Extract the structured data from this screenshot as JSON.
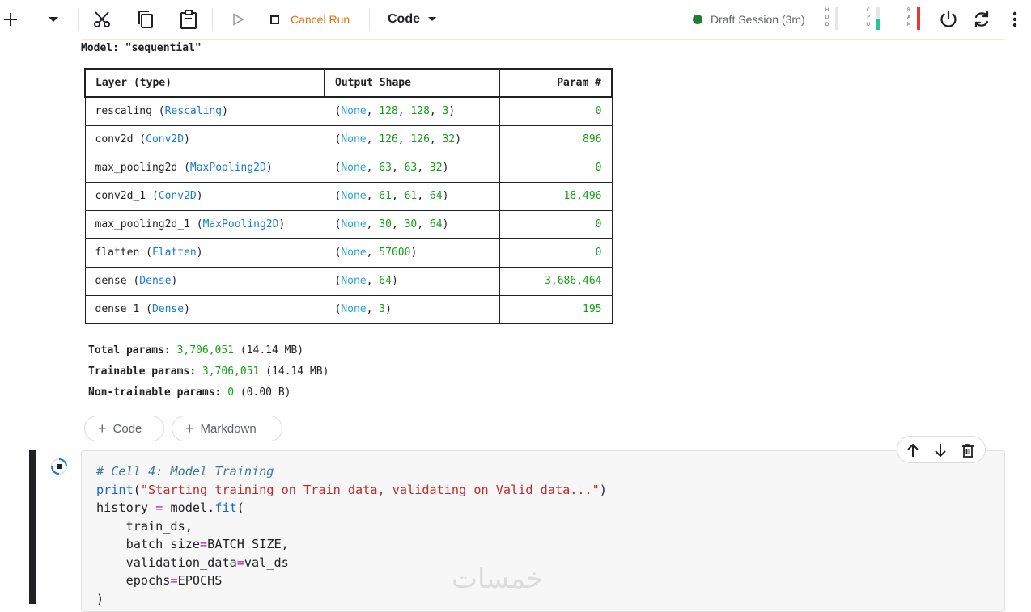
{
  "toolbar": {
    "cancel_run_label": "Cancel Run",
    "cell_type_label": "Code",
    "session_label": "Draft Session (3m)",
    "meters": [
      {
        "label": "HDD",
        "letters": [
          "H",
          "D",
          "D"
        ],
        "level": 0.0,
        "color": "#9e9e9e"
      },
      {
        "label": "CPU",
        "letters": [
          "C",
          "P",
          "U"
        ],
        "level": 0.45,
        "color": "#20c997"
      },
      {
        "label": "RAM",
        "letters": [
          "R",
          "A",
          "M"
        ],
        "level": 1.0,
        "color": "#e53935"
      }
    ]
  },
  "output": {
    "model_title": "Model: \"sequential\"",
    "columns": [
      "Layer (type)",
      "Output Shape",
      "Param #"
    ],
    "rows": [
      {
        "name": "rescaling",
        "type": "Rescaling",
        "shape": [
          "None",
          "128",
          "128",
          "3"
        ],
        "params": "0"
      },
      {
        "name": "conv2d",
        "type": "Conv2D",
        "shape": [
          "None",
          "126",
          "126",
          "32"
        ],
        "params": "896"
      },
      {
        "name": "max_pooling2d",
        "type": "MaxPooling2D",
        "shape": [
          "None",
          "63",
          "63",
          "32"
        ],
        "params": "0"
      },
      {
        "name": "conv2d_1",
        "type": "Conv2D",
        "shape": [
          "None",
          "61",
          "61",
          "64"
        ],
        "params": "18,496"
      },
      {
        "name": "max_pooling2d_1",
        "type": "MaxPooling2D",
        "shape": [
          "None",
          "30",
          "30",
          "64"
        ],
        "params": "0"
      },
      {
        "name": "flatten",
        "type": "Flatten",
        "shape": [
          "None",
          "57600"
        ],
        "params": "0"
      },
      {
        "name": "dense",
        "type": "Dense",
        "shape": [
          "None",
          "64"
        ],
        "params": "3,686,464"
      },
      {
        "name": "dense_1",
        "type": "Dense",
        "shape": [
          "None",
          "3"
        ],
        "params": "195"
      }
    ],
    "totals": [
      {
        "label": "Total params:",
        "value": "3,706,051",
        "size": "(14.14 MB)"
      },
      {
        "label": "Trainable params:",
        "value": "3,706,051",
        "size": "(14.14 MB)"
      },
      {
        "label": "Non-trainable params:",
        "value": "0",
        "size": "(0.00 B)"
      }
    ]
  },
  "add_buttons": {
    "code": "Code",
    "markdown": "Markdown"
  },
  "code_cell": {
    "lines": [
      [
        {
          "c": "comment",
          "t": "# Cell 4: Model Training"
        }
      ],
      [
        {
          "c": "fn",
          "t": "print"
        },
        {
          "c": "txt",
          "t": "("
        },
        {
          "c": "str",
          "t": "\"Starting training on Train data, validating on Valid data...\""
        },
        {
          "c": "txt",
          "t": ")"
        }
      ],
      [
        {
          "c": "txt",
          "t": "history "
        },
        {
          "c": "op",
          "t": "="
        },
        {
          "c": "txt",
          "t": " model."
        },
        {
          "c": "fn",
          "t": "fit"
        },
        {
          "c": "txt",
          "t": "("
        }
      ],
      [
        {
          "c": "txt",
          "t": "    train_ds,"
        }
      ],
      [
        {
          "c": "txt",
          "t": "    batch_size"
        },
        {
          "c": "op",
          "t": "="
        },
        {
          "c": "txt",
          "t": "BATCH_SIZE,"
        }
      ],
      [
        {
          "c": "txt",
          "t": "    validation_data"
        },
        {
          "c": "op",
          "t": "="
        },
        {
          "c": "txt",
          "t": "val_ds"
        }
      ],
      [
        {
          "c": "txt",
          "t": "    epochs"
        },
        {
          "c": "op",
          "t": "="
        },
        {
          "c": "txt",
          "t": "EPOCHS"
        }
      ],
      [
        {
          "c": "txt",
          "t": ")"
        }
      ]
    ]
  },
  "watermark": "خمسات"
}
